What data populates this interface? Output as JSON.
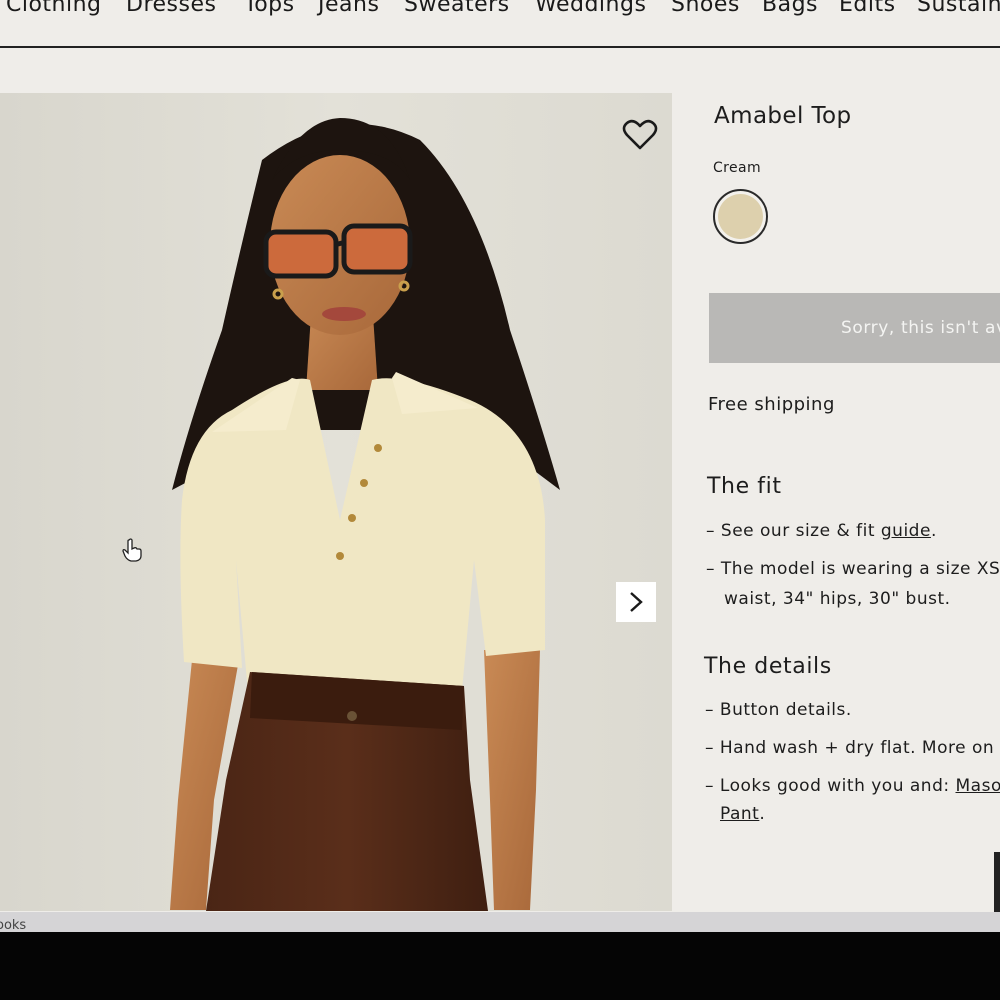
{
  "nav": {
    "items": [
      "Clothing",
      "Dresses",
      "Tops",
      "Jeans",
      "Sweaters",
      "Weddings",
      "Shoes",
      "Bags",
      "Edits",
      "Sustain"
    ]
  },
  "product": {
    "title": "Amabel Top",
    "color_label": "Cream",
    "swatch_color": "#ddd0ad",
    "unavailable_text": "Sorry, this isn't av",
    "shipping_text": "Free shipping"
  },
  "fit": {
    "heading": "The fit",
    "line1_prefix": "– See our size & fit ",
    "line1_link": "guide",
    "line1_suffix": ".",
    "line2": "– The model is wearing a size XS",
    "line3": "waist, 34\" hips, 30\" bust."
  },
  "details": {
    "heading": "The details",
    "line1": "– Button details.",
    "line2": "– Hand wash + dry flat. More on",
    "line3_prefix": "– Looks good with you and: ",
    "line3_link": "Maso",
    "line4_link": "Pant",
    "line4_suffix": "."
  },
  "footer": {
    "text": "ooks"
  },
  "icons": {
    "wishlist": "heart-icon",
    "next": "chevron-right-icon",
    "cursor": "hand-pointer-icon"
  }
}
